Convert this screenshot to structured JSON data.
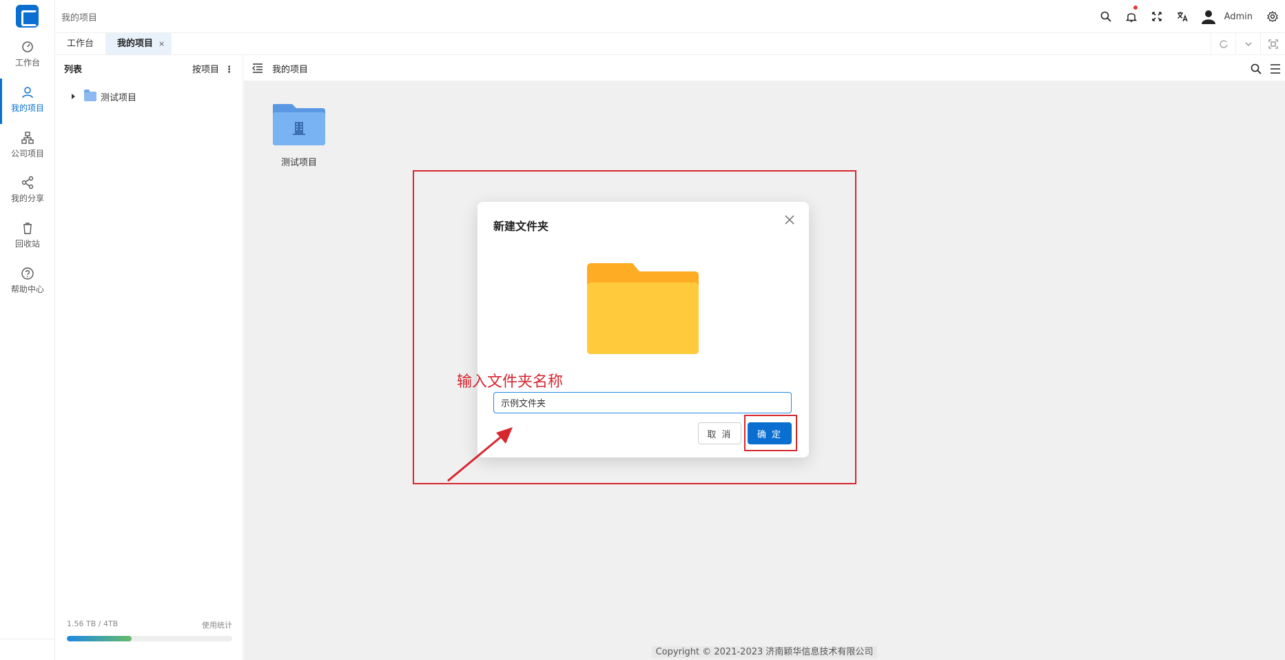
{
  "header": {
    "breadcrumb": "我的项目",
    "username": "Admin",
    "icons": [
      "search-icon",
      "bell-icon",
      "fullscreen-icon",
      "translate-icon",
      "avatar",
      "gear-icon"
    ]
  },
  "sidebar": {
    "items": [
      {
        "label": "工作台",
        "icon": "dashboard-icon"
      },
      {
        "label": "我的项目",
        "icon": "user-icon",
        "active": true
      },
      {
        "label": "公司项目",
        "icon": "org-icon"
      },
      {
        "label": "我的分享",
        "icon": "share-icon"
      },
      {
        "label": "回收站",
        "icon": "trash-icon"
      },
      {
        "label": "帮助中心",
        "icon": "help-icon"
      }
    ]
  },
  "tabs": [
    {
      "label": "工作台"
    },
    {
      "label": "我的项目",
      "active": true,
      "close": "×"
    }
  ],
  "panel": {
    "title": "列表",
    "sort_label": "按项目",
    "tree": [
      {
        "label": "测试项目"
      }
    ],
    "usage_text": "1.56 TB / 4TB",
    "usage_link": "使用统计",
    "usage_fraction": 0.39
  },
  "main": {
    "title": "我的项目",
    "items": [
      {
        "label": "测试项目"
      }
    ],
    "copyright": "Copyright © 2021-2023 济南颖华信息技术有限公司"
  },
  "dialog": {
    "title": "新建文件夹",
    "input_value": "示例文件夹",
    "cancel_label": "取 消",
    "ok_label": "确 定"
  },
  "annotation": {
    "text": "输入文件夹名称"
  },
  "colors": {
    "accent": "#0a6fd0",
    "highlight": "#d6262e",
    "folder_yellow": "#ffcb3d",
    "folder_blue": "#7ab3f3"
  }
}
